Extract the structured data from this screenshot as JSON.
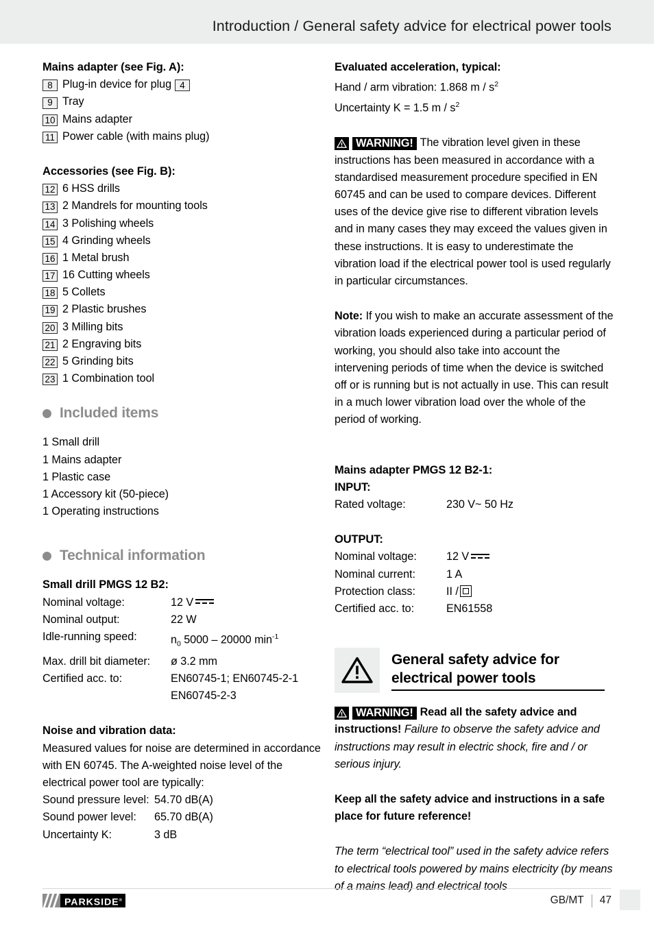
{
  "header": {
    "title": "Introduction / General safety advice for electrical power tools"
  },
  "left_column": {
    "mains_adapter": {
      "heading": "Mains adapter (see Fig. A):",
      "items": [
        {
          "num": "8",
          "label_before": "Plug-in device for plug",
          "inline_num": "4"
        },
        {
          "num": "9",
          "label_before": "Tray"
        },
        {
          "num": "10",
          "label_before": "Mains adapter"
        },
        {
          "num": "11",
          "label_before": "Power cable (with mains plug)"
        }
      ]
    },
    "accessories": {
      "heading": "Accessories (see Fig. B):",
      "items": [
        {
          "num": "12",
          "label_before": "6 HSS drills"
        },
        {
          "num": "13",
          "label_before": "2 Mandrels for mounting tools"
        },
        {
          "num": "14",
          "label_before": "3 Polishing wheels"
        },
        {
          "num": "15",
          "label_before": "4 Grinding wheels"
        },
        {
          "num": "16",
          "label_before": "1 Metal brush"
        },
        {
          "num": "17",
          "label_before": "16 Cutting wheels"
        },
        {
          "num": "18",
          "label_before": "5 Collets"
        },
        {
          "num": "19",
          "label_before": "2 Plastic brushes"
        },
        {
          "num": "20",
          "label_before": "3 Milling bits"
        },
        {
          "num": "21",
          "label_before": "2 Engraving bits"
        },
        {
          "num": "22",
          "label_before": "5 Grinding bits"
        },
        {
          "num": "23",
          "label_before": "1 Combination tool"
        }
      ]
    },
    "included_items": {
      "heading": "Included items",
      "lines": [
        "1 Small drill",
        "1 Mains adapter",
        "1 Plastic case",
        "1 Accessory kit (50-piece)",
        "1 Operating instructions"
      ]
    },
    "technical_information": {
      "heading": "Technical information",
      "small_drill_heading": "Small drill PMGS 12 B2:",
      "specs": [
        {
          "key": "Nominal voltage:",
          "value": "12 V",
          "symbol": "dc"
        },
        {
          "key": "Nominal output:",
          "value": "22 W"
        },
        {
          "key": "Idle-running speed:",
          "value": "n",
          "sub": "0",
          "value2": " 5000 – 20000 min",
          "sup": "-1"
        },
        {
          "key": "Max. drill bit diameter:",
          "value": "ø 3.2 mm"
        },
        {
          "key": "Certified acc. to:",
          "value": "EN60745-1; EN60745-2-1"
        },
        {
          "key": "",
          "value": "EN60745-2-3"
        }
      ],
      "noise_heading": "Noise and vibration data:",
      "noise_paragraph": "Measured values for noise are determined in accordance with EN 60745. The A-weighted noise level of the electrical power tool are typically:",
      "noise_specs": [
        {
          "key": "Sound pressure level:",
          "value": "54.70 dB(A)"
        },
        {
          "key": "Sound power level:",
          "value": "65.70 dB(A)"
        },
        {
          "key": "Uncertainty K:",
          "value": "3 dB"
        }
      ]
    }
  },
  "right_column": {
    "evaluated_acceleration": {
      "heading": "Evaluated acceleration, typical:",
      "line1_pre": "Hand / arm vibration: 1.868 m / s",
      "line1_sup": "2",
      "line2_pre": "Uncertainty K = 1.5 m / s",
      "line2_sup": "2"
    },
    "warning_1": {
      "badge_label": "WARNING!",
      "text": "The vibration level given in these instructions has been measured in accordance with a standardised measurement procedure specified in EN 60745 and can be used to compare devices. Different uses of the device give rise to different vibration levels and in many cases they may exceed the values given in these instructions. It is easy to underestimate the vibration load if the electrical power tool is used regularly in particular circumstances."
    },
    "note": {
      "label": "Note:",
      "text": " If you wish to make an accurate assessment of the vibration loads experienced during a particular period of working, you should also take into account the intervening periods of time when the device is switched off or is running but is not actually in use. This can result in a much lower vibration load over the whole of the period of working."
    },
    "mains_adapter_specs": {
      "heading": "Mains adapter PMGS 12 B2-1:",
      "input_heading": "INPUT:",
      "input_specs": [
        {
          "key": "Rated voltage:",
          "value": "230 V~ 50 Hz"
        }
      ],
      "output_heading": "OUTPUT:",
      "output_specs": [
        {
          "key": "Nominal voltage:",
          "value": "12 V",
          "symbol": "dc"
        },
        {
          "key": "Nominal current:",
          "value": "1 A"
        },
        {
          "key": "Protection class:",
          "value": "II /",
          "symbol": "class2"
        },
        {
          "key": "Certified acc. to:",
          "value": "EN61558"
        }
      ]
    },
    "general_safety": {
      "heading_line1": "General safety advice for",
      "heading_line2": "electrical power tools",
      "warning_badge_label": "WARNING!",
      "warning_bold_1": "Read all the safety advice and instructions!",
      "warning_italic_1": " Failure to observe the safety advice and instructions may result in electric shock, fire and / or serious injury.",
      "keep_bold": "Keep all the safety advice and instructions in a safe place for future reference!",
      "term_italic": "The term “electrical tool” used in the safety advice refers to electrical tools powered by mains electricity (by means of a mains lead) and electrical tools"
    }
  },
  "footer": {
    "logo_text": "PARKSIDE",
    "logo_reg": "®",
    "locale": "GB/MT",
    "page": "47"
  }
}
